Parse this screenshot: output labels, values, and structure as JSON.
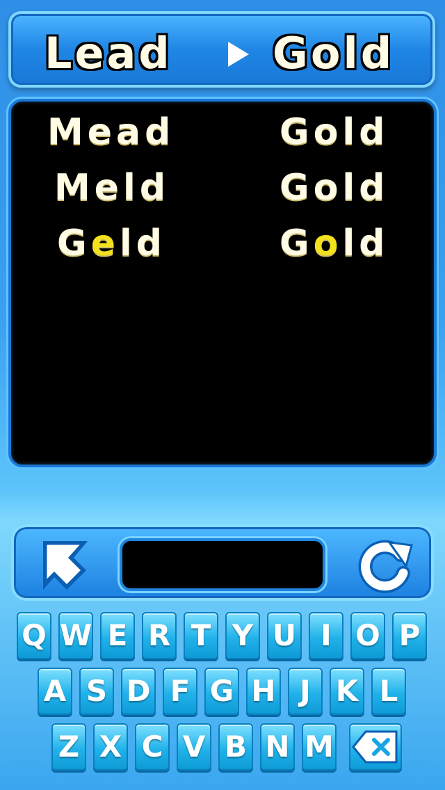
{
  "header": {
    "start_word": "Lead",
    "target_word": "Gold"
  },
  "board": {
    "rows": [
      {
        "left": [
          "M",
          "e",
          "a",
          "d"
        ],
        "left_hl": -1,
        "right": [
          "G",
          "o",
          "l",
          "d"
        ],
        "right_hl": -1
      },
      {
        "left": [
          "M",
          "e",
          "l",
          "d"
        ],
        "left_hl": -1,
        "right": [
          "G",
          "o",
          "l",
          "d"
        ],
        "right_hl": -1
      },
      {
        "left": [
          "G",
          "e",
          "l",
          "d"
        ],
        "left_hl": 1,
        "right": [
          "G",
          "o",
          "l",
          "d"
        ],
        "right_hl": 1
      }
    ]
  },
  "controls": {
    "answer_value": ""
  },
  "icons": {
    "hint": "arrow-up-left-icon",
    "restart": "restart-icon",
    "delete": "backspace-icon"
  },
  "keyboard": {
    "rows": [
      [
        "Q",
        "W",
        "E",
        "R",
        "T",
        "Y",
        "U",
        "I",
        "O",
        "P"
      ],
      [
        "A",
        "S",
        "D",
        "F",
        "G",
        "H",
        "J",
        "K",
        "L"
      ],
      [
        "Z",
        "X",
        "C",
        "V",
        "B",
        "N",
        "M"
      ]
    ]
  },
  "colors": {
    "highlight": "#f2e11c",
    "letter": "#fffbe4",
    "key": "#22b2ea"
  }
}
